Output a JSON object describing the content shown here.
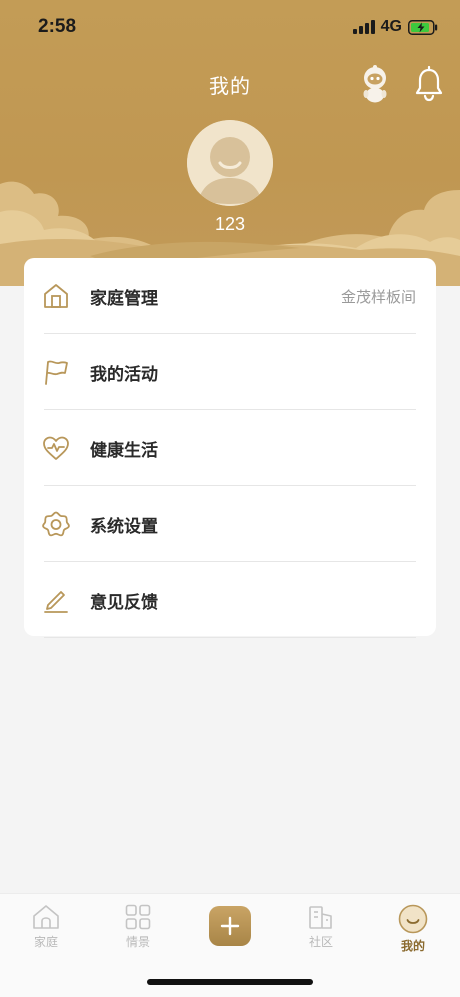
{
  "status_bar": {
    "time": "2:58",
    "network": "4G"
  },
  "header": {
    "title": "我的",
    "username": "123",
    "background_color": "#c39c56"
  },
  "menu": {
    "items": [
      {
        "label": "家庭管理",
        "value": "金茂样板间",
        "icon": "house-icon"
      },
      {
        "label": "我的活动",
        "value": "",
        "icon": "flag-icon"
      },
      {
        "label": "健康生活",
        "value": "",
        "icon": "heart-pulse-icon"
      },
      {
        "label": "系统设置",
        "value": "",
        "icon": "gear-icon"
      },
      {
        "label": "意见反馈",
        "value": "",
        "icon": "pen-icon"
      }
    ]
  },
  "bottom_nav": {
    "items": [
      {
        "label": "家庭",
        "icon": "home-icon",
        "active": false
      },
      {
        "label": "情景",
        "icon": "grid-icon",
        "active": false
      },
      {
        "label": "",
        "icon": "plus-icon",
        "active": false
      },
      {
        "label": "社区",
        "icon": "building-icon",
        "active": false
      },
      {
        "label": "我的",
        "icon": "smile-icon",
        "active": true
      }
    ]
  },
  "colors": {
    "accent": "#b8975a",
    "active_tab": "#8a6a2e"
  }
}
